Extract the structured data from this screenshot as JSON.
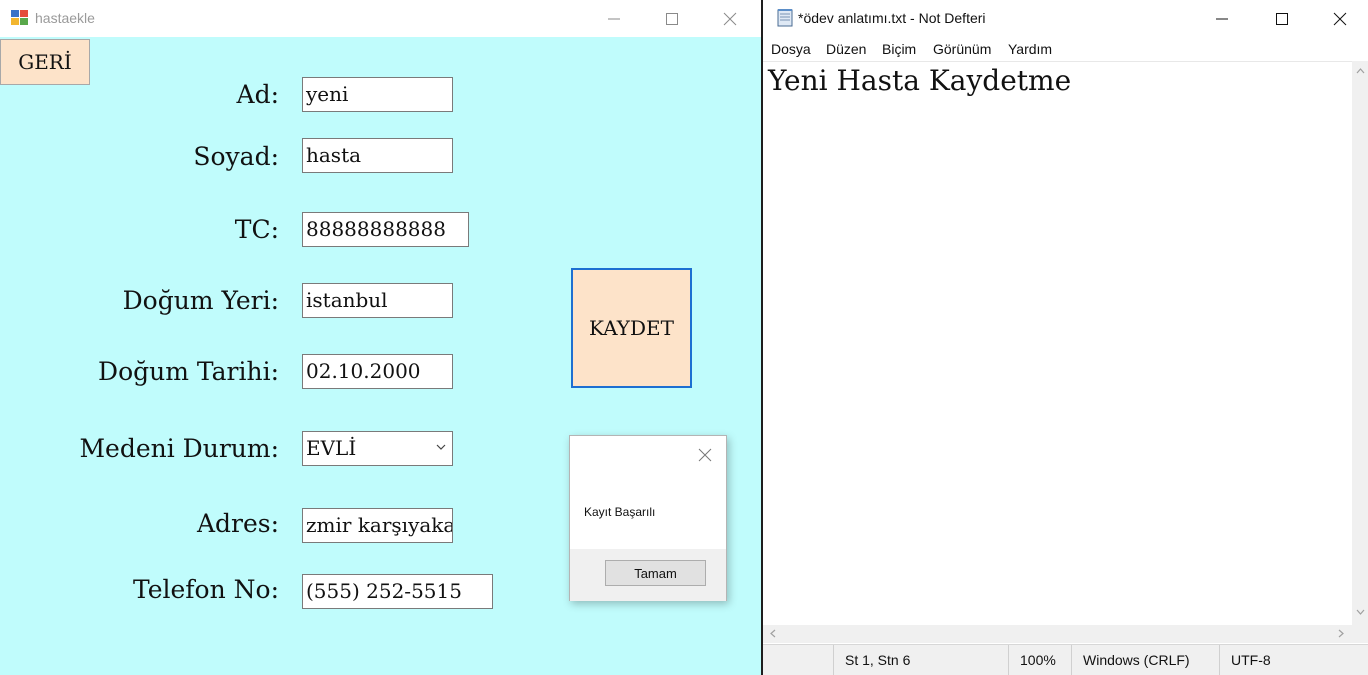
{
  "left_window": {
    "title": "hastaekle",
    "back_button": "GERİ",
    "fields": [
      {
        "label": "Ad:",
        "value": "yeni"
      },
      {
        "label": "Soyad:",
        "value": "hasta"
      },
      {
        "label": "TC:",
        "value": "88888888888"
      },
      {
        "label": "Doğum Yeri:",
        "value": "istanbul"
      },
      {
        "label": "Doğum Tarihi:",
        "value": "02.10.2000"
      },
      {
        "label": "Medeni Durum:",
        "value": "EVLİ"
      },
      {
        "label": "Adres:",
        "value": "zmir karşıyaka"
      },
      {
        "label": "Telefon No:",
        "value": "(555) 252-5515"
      }
    ],
    "save_button": "KAYDET",
    "background_color": "#c0fcfc",
    "button_color": "#fde3c9"
  },
  "message_box": {
    "text": "Kayıt Başarılı",
    "ok_button": "Tamam"
  },
  "right_window": {
    "title": "*ödev anlatımı.txt - Not Defteri",
    "menu": [
      "Dosya",
      "Düzen",
      "Biçim",
      "Görünüm",
      "Yardım"
    ],
    "content": "Yeni Hasta Kaydetme",
    "status": {
      "position": "St 1, Stn 6",
      "zoom": "100%",
      "line_ending": "Windows (CRLF)",
      "encoding": "UTF-8"
    }
  }
}
